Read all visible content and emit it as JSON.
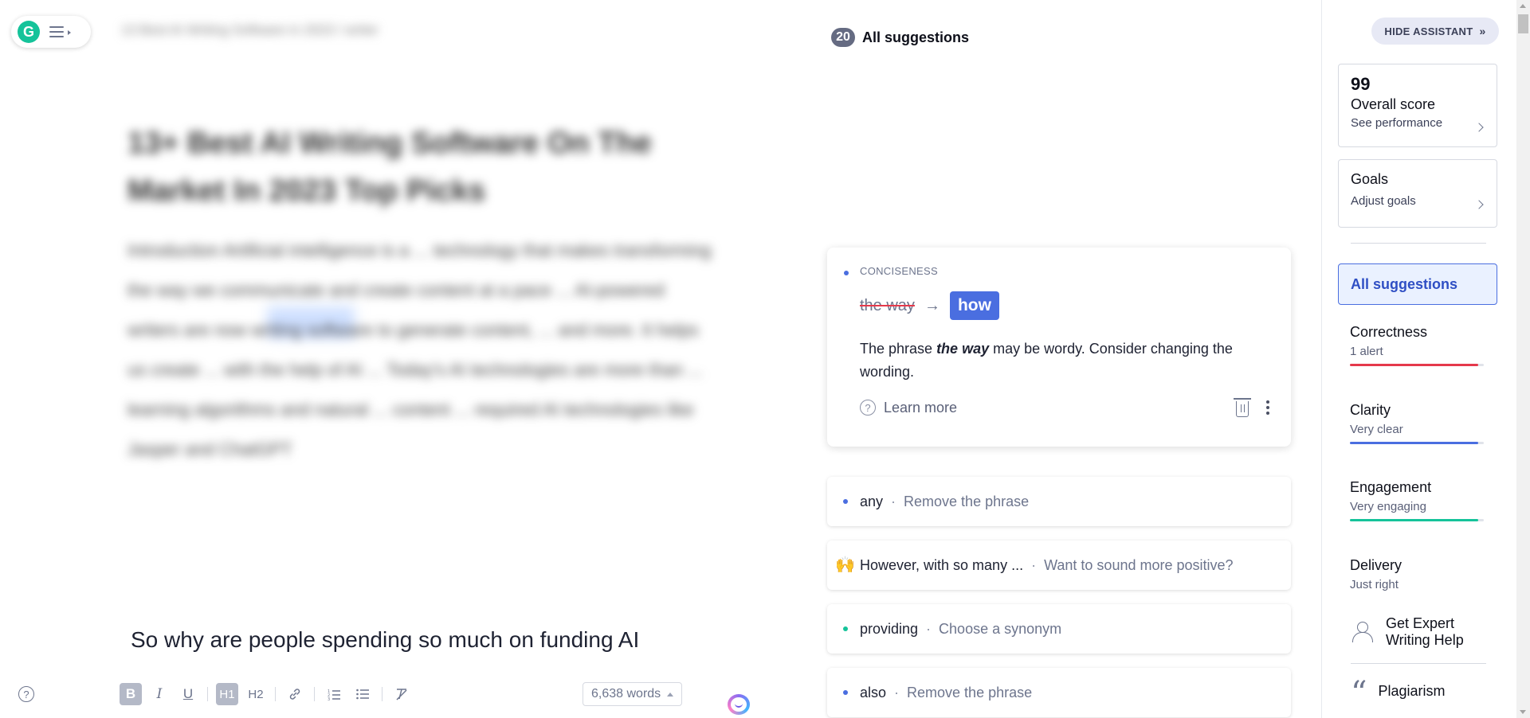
{
  "editor": {
    "blurred_title": "13 Best AI Writing Software in 2023 / writer",
    "blurred_heading": "13+ Best AI Writing Software On The Market In 2023 Top Picks",
    "blurred_paragraph": "Introduction Artificial intelligence is a ... technology that makes transforming the way we communicate and create content at a pace ... AI-powered writers are now writing software to generate content, ... and more. It helps us create ... with the help of AI ... Today's AI technologies are more than ... learning algorithms and natural ... content ... required AI technologies like Jasper and ChatGPT",
    "visible_line": "So why are people spending so much on funding AI",
    "word_count": "6,638 words",
    "toolbar": {
      "bold": "B",
      "italic": "I",
      "underline": "U",
      "h1": "H1",
      "h2": "H2"
    }
  },
  "suggestions": {
    "count": "20",
    "title": "All suggestions",
    "expanded": {
      "category": "CONCISENESS",
      "original": "the way",
      "replacement": "how",
      "explanation_pre": "The phrase ",
      "explanation_bold": "the way",
      "explanation_post": " may be wordy. Consider changing the wording.",
      "learn_more": "Learn more"
    },
    "items": [
      {
        "main": "any",
        "sep": "·",
        "desc": "Remove the phrase"
      },
      {
        "main": "However, with so many ...",
        "sep": "·",
        "desc": "Want to sound more positive?"
      },
      {
        "main": "providing",
        "sep": "·",
        "desc": "Choose a synonym"
      },
      {
        "main": "also",
        "sep": "·",
        "desc": "Remove the phrase"
      }
    ]
  },
  "sidebar": {
    "hide_assistant": "HIDE ASSISTANT",
    "score": {
      "value": "99",
      "title": "Overall score",
      "link": "See performance"
    },
    "goals": {
      "title": "Goals",
      "link": "Adjust goals"
    },
    "all_suggestions": "All suggestions",
    "categories": [
      {
        "name": "Correctness",
        "status": "1 alert",
        "color": "#e5394b",
        "fill": 0.96
      },
      {
        "name": "Clarity",
        "status": "Very clear",
        "color": "#4a6ee0",
        "fill": 0.96
      },
      {
        "name": "Engagement",
        "status": "Very engaging",
        "color": "#15c39a",
        "fill": 0.96
      },
      {
        "name": "Delivery",
        "status": "Just right"
      }
    ],
    "expert_help": "Get Expert Writing Help",
    "plagiarism": "Plagiarism"
  },
  "colors": {
    "brand_green": "#15c39a",
    "accent_blue": "#4a6ee0",
    "alert_red": "#e5394b"
  }
}
